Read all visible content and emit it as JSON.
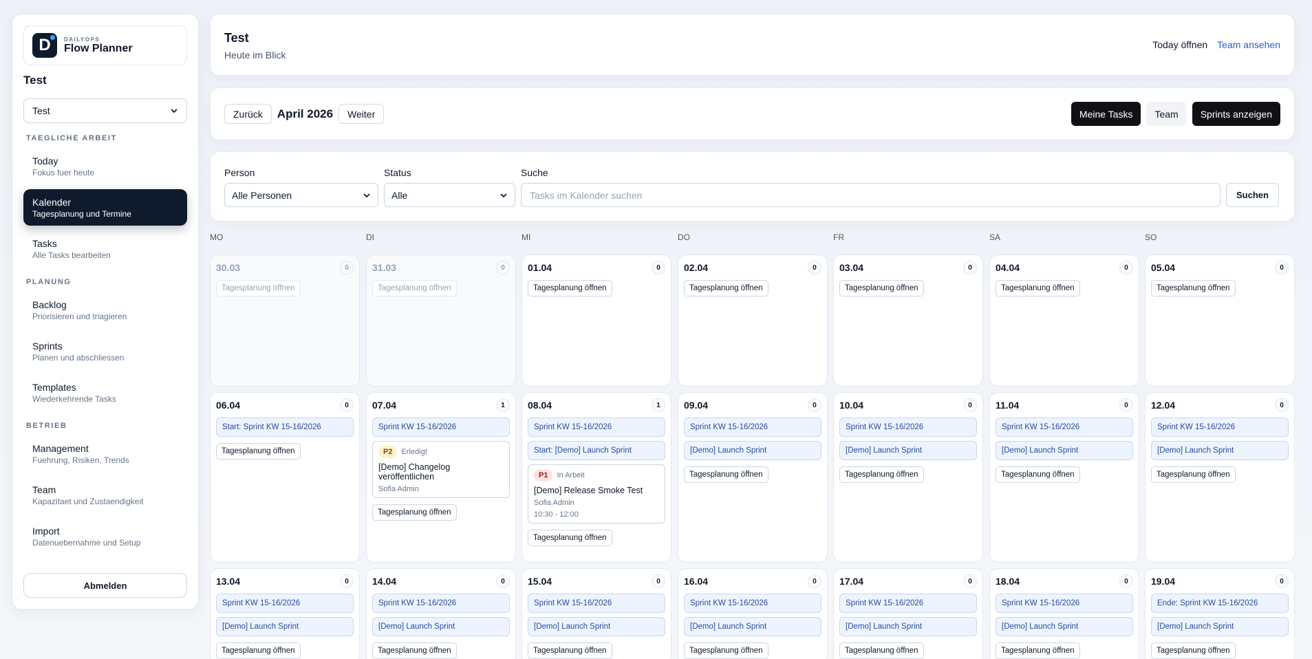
{
  "sidebar": {
    "brand_small": "DAILYOPS",
    "brand_name": "Flow Planner",
    "brand_letter": "D",
    "workspace_title": "Test",
    "workspace_select": "Test",
    "sections": [
      {
        "label": "TAEGLICHE ARBEIT",
        "items": [
          {
            "title": "Today",
            "sub": "Fokus fuer heute",
            "active": false
          },
          {
            "title": "Kalender",
            "sub": "Tagesplanung und Termine",
            "active": true
          },
          {
            "title": "Tasks",
            "sub": "Alle Tasks bearbeiten",
            "active": false
          }
        ]
      },
      {
        "label": "PLANUNG",
        "items": [
          {
            "title": "Backlog",
            "sub": "Priorisieren und triagieren",
            "active": false
          },
          {
            "title": "Sprints",
            "sub": "Planen und abschliessen",
            "active": false
          },
          {
            "title": "Templates",
            "sub": "Wiederkehrende Tasks",
            "active": false
          }
        ]
      },
      {
        "label": "BETRIEB",
        "items": [
          {
            "title": "Management",
            "sub": "Fuehrung, Risiken, Trends",
            "active": false
          },
          {
            "title": "Team",
            "sub": "Kapazitaet und Zustaendigkeit",
            "active": false
          },
          {
            "title": "Import",
            "sub": "Datenuebernahme und Setup",
            "active": false
          }
        ]
      }
    ],
    "logout": "Abmelden"
  },
  "header": {
    "title": "Test",
    "subtitle": "Heute im Blick",
    "link_today": "Today öffnen",
    "link_team": "Team ansehen"
  },
  "calnav": {
    "back": "Zurück",
    "month": "April 2026",
    "next": "Weiter",
    "my_tasks": "Meine Tasks",
    "team": "Team",
    "sprints": "Sprints anzeigen"
  },
  "filters": {
    "person_label": "Person",
    "person_value": "Alle Personen",
    "status_label": "Status",
    "status_value": "Alle",
    "search_label": "Suche",
    "search_placeholder": "Tasks im Kalender suchen",
    "search_button": "Suchen"
  },
  "weekdays": [
    "MO",
    "DI",
    "MI",
    "DO",
    "FR",
    "SA",
    "SO"
  ],
  "plan_label": "Tagesplanung öffnen",
  "weeks": [
    [
      {
        "date": "30.03",
        "count": "0",
        "muted": true,
        "chips": [],
        "tasks": []
      },
      {
        "date": "31.03",
        "count": "0",
        "muted": true,
        "chips": [],
        "tasks": []
      },
      {
        "date": "01.04",
        "count": "0",
        "chips": [],
        "tasks": []
      },
      {
        "date": "02.04",
        "count": "0",
        "chips": [],
        "tasks": []
      },
      {
        "date": "03.04",
        "count": "0",
        "chips": [],
        "tasks": []
      },
      {
        "date": "04.04",
        "count": "0",
        "chips": [],
        "tasks": []
      },
      {
        "date": "05.04",
        "count": "0",
        "chips": [],
        "tasks": []
      }
    ],
    [
      {
        "date": "06.04",
        "count": "0",
        "chips": [
          "Start: Sprint KW 15-16/2026"
        ],
        "tasks": []
      },
      {
        "date": "07.04",
        "count": "1",
        "chips": [
          "Sprint KW 15-16/2026"
        ],
        "tasks": [
          {
            "priority": "P2",
            "status": "Erledigt",
            "title": "[Demo] Changelog veröffentlichen",
            "owner": "Sofia Admin",
            "time": ""
          }
        ]
      },
      {
        "date": "08.04",
        "count": "1",
        "chips": [
          "Sprint KW 15-16/2026",
          "Start: [Demo] Launch Sprint"
        ],
        "tasks": [
          {
            "priority": "P1",
            "status": "In Arbeit",
            "title": "[Demo] Release Smoke Test",
            "owner": "Sofia Admin",
            "time": "10:30 - 12:00"
          }
        ]
      },
      {
        "date": "09.04",
        "count": "0",
        "chips": [
          "Sprint KW 15-16/2026",
          "[Demo] Launch Sprint"
        ],
        "tasks": []
      },
      {
        "date": "10.04",
        "count": "0",
        "chips": [
          "Sprint KW 15-16/2026",
          "[Demo] Launch Sprint"
        ],
        "tasks": []
      },
      {
        "date": "11.04",
        "count": "0",
        "chips": [
          "Sprint KW 15-16/2026",
          "[Demo] Launch Sprint"
        ],
        "tasks": []
      },
      {
        "date": "12.04",
        "count": "0",
        "chips": [
          "Sprint KW 15-16/2026",
          "[Demo] Launch Sprint"
        ],
        "tasks": []
      }
    ],
    [
      {
        "date": "13.04",
        "count": "0",
        "chips": [
          "Sprint KW 15-16/2026",
          "[Demo] Launch Sprint"
        ],
        "tasks": []
      },
      {
        "date": "14.04",
        "count": "0",
        "chips": [
          "Sprint KW 15-16/2026",
          "[Demo] Launch Sprint"
        ],
        "tasks": []
      },
      {
        "date": "15.04",
        "count": "0",
        "chips": [
          "Sprint KW 15-16/2026",
          "[Demo] Launch Sprint"
        ],
        "tasks": []
      },
      {
        "date": "16.04",
        "count": "0",
        "chips": [
          "Sprint KW 15-16/2026",
          "[Demo] Launch Sprint"
        ],
        "tasks": []
      },
      {
        "date": "17.04",
        "count": "0",
        "chips": [
          "Sprint KW 15-16/2026",
          "[Demo] Launch Sprint"
        ],
        "tasks": []
      },
      {
        "date": "18.04",
        "count": "0",
        "chips": [
          "Sprint KW 15-16/2026",
          "[Demo] Launch Sprint"
        ],
        "tasks": []
      },
      {
        "date": "19.04",
        "count": "0",
        "chips": [
          "Ende: Sprint KW 15-16/2026",
          "[Demo] Launch Sprint"
        ],
        "tasks": []
      }
    ]
  ]
}
